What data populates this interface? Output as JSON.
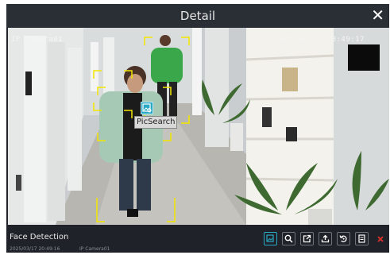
{
  "dialog": {
    "title": "Detail"
  },
  "video": {
    "camera_osd": "IP Camera01",
    "timestamp_osd": "2025/03/17 20:49:17",
    "pic_search_tooltip": "PicSearch"
  },
  "footer": {
    "event_type": "Face Detection",
    "event_time": "2025/03/17 20:49:16",
    "event_camera": "IP Camera01"
  },
  "toolbar": {
    "buttons": [
      "pic-search",
      "search",
      "export",
      "backup",
      "playback",
      "detail",
      "delete"
    ]
  },
  "colors": {
    "accent": "#2aa9c4",
    "face_box": "#f2e600",
    "delete": "#e0302a"
  }
}
